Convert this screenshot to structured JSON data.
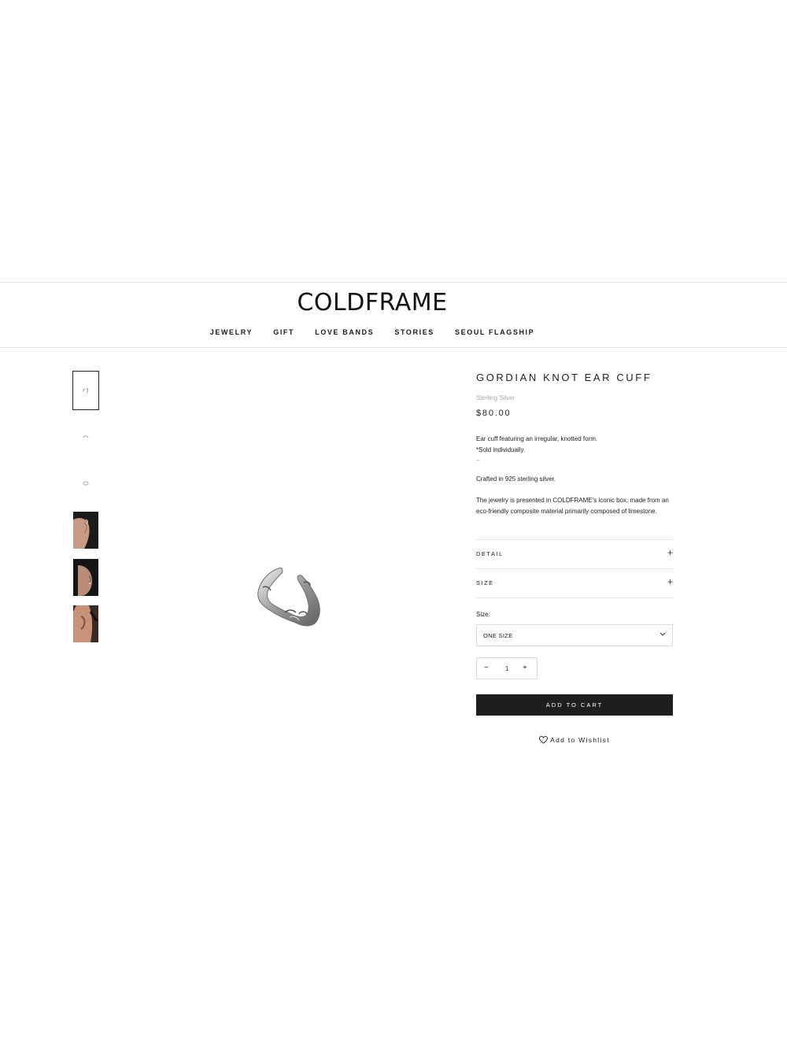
{
  "brand": {
    "name": "COLDFRAME"
  },
  "nav": [
    "JEWELRY",
    "GIFT",
    "LOVE BANDS",
    "STORIES",
    "SEOUL FLAGSHIP"
  ],
  "product": {
    "title": "GORDIAN KNOT EAR CUFF",
    "material": "Sterling Silver",
    "price": "$80.00",
    "description": [
      "Ear cuff featuring an irregular, knotted form.",
      "*Sold individually."
    ],
    "dash": "–",
    "crafted": "Crafted in 925 sterling silver.",
    "packaging": "The jewelry is presented in COLDFRAME’s iconic box, made from an eco-friendly composite material primarily composed of limestone."
  },
  "accordions": [
    {
      "label": "DETAIL",
      "icon": "plus-icon"
    },
    {
      "label": "SIZE",
      "icon": "plus-icon"
    }
  ],
  "size_select": {
    "label": "Size:",
    "value": "ONE SIZE"
  },
  "quantity": {
    "value": "1"
  },
  "actions": {
    "add_to_cart": "ADD TO CART",
    "wishlist": "Add to Wishlist"
  },
  "colors": {
    "button_bg": "#1e1e1e",
    "muted_text": "#a8a8a8",
    "divider": "#e4e4e4"
  }
}
